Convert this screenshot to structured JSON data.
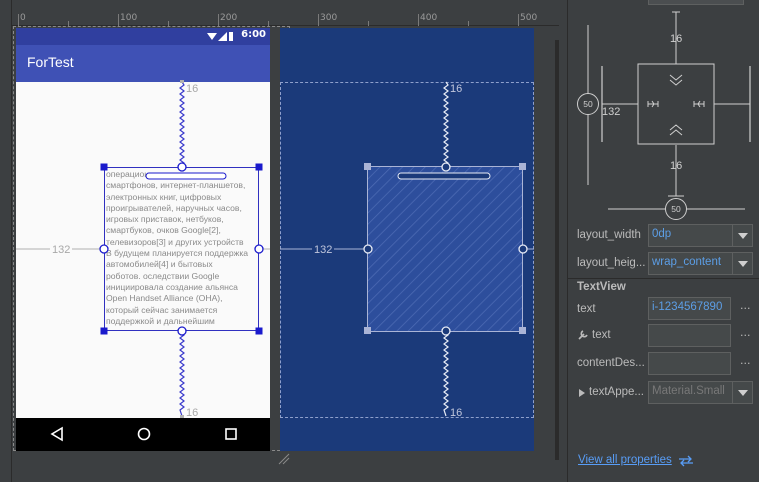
{
  "ruler": {
    "ticks": [
      "0",
      "100",
      "200",
      "300",
      "400",
      "500"
    ]
  },
  "phone": {
    "status_time": "6:00",
    "app_title": "ForTest",
    "body_text": "операционная система для\nсмартфонов, интернет-планшетов,\nэлектронных книг, цифровых\nпроигрывателей, наручных часов,\nигровых приставок, нетбуков,\nсмартбуков, очков Google[2],\nтелевизоров[3] и других устройств\nВ будущем планируется поддержка\nавтомобилей[4] и бытовых\nроботов. оследствии Google\nинициировала создание альянса\nOpen Handset Alliance (OHA),\nкоторый сейчас занимается\nподдержкой и дальнейшим",
    "margin_top": "16",
    "margin_bottom": "16",
    "margin_left": "132"
  },
  "blueprint": {
    "margin_top": "16",
    "margin_bottom": "16",
    "margin_left": "132"
  },
  "constraint_widget": {
    "top": "16",
    "bottom": "16",
    "left": "132",
    "vertical_bias": "50",
    "horizontal_bias": "50"
  },
  "attributes": {
    "layout_width_label": "layout_width",
    "layout_width_value": "0dp",
    "layout_height_label": "layout_heig...",
    "layout_height_value": "wrap_content",
    "section_title": "TextView",
    "text_label": "text",
    "text_value": "i-1234567890",
    "tools_text_label": "text",
    "tools_text_value": "",
    "content_desc_label": "contentDes...",
    "content_desc_value": "",
    "text_appearance_label": "textAppe...",
    "text_appearance_value": "Material.Small",
    "ellipsis": "···",
    "view_all": "View all properties"
  }
}
